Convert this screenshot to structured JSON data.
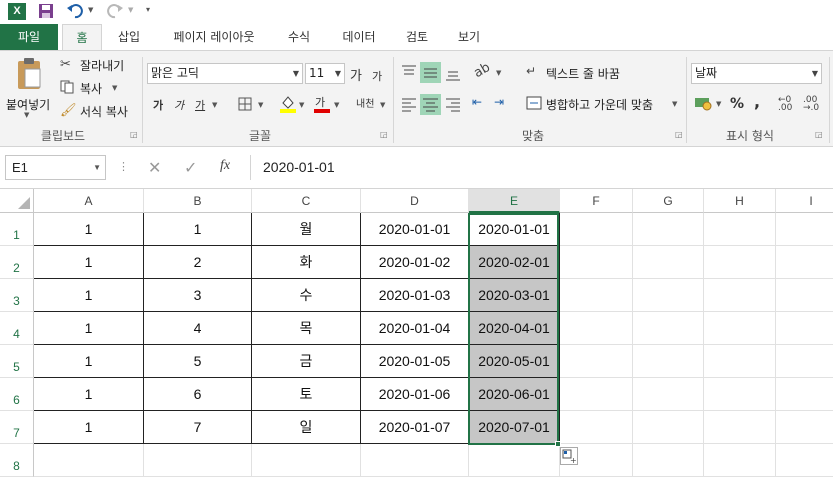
{
  "quick_access": {
    "app_icon": "excel-icon",
    "save_icon": "save-icon",
    "undo_icon": "undo-icon",
    "redo_icon": "redo-icon",
    "customize_icon": "customize-icon",
    "brand_color": "#217346"
  },
  "tabs": [
    {
      "label": "파일"
    },
    {
      "label": "홈"
    },
    {
      "label": "삽입"
    },
    {
      "label": "페이지 레이아웃"
    },
    {
      "label": "수식"
    },
    {
      "label": "데이터"
    },
    {
      "label": "검토"
    },
    {
      "label": "보기"
    }
  ],
  "ribbon": {
    "clipboard": {
      "paste_label": "붙여넣기",
      "cut_label": "잘라내기",
      "copy_label": "복사",
      "format_painter_label": "서식 복사",
      "group_label": "클립보드"
    },
    "font": {
      "font_name": "맑은 고딕",
      "font_size": "11",
      "bold": "가",
      "italic": "가",
      "underline": "가",
      "increase_size": "가",
      "decrease_size": "가",
      "font_color_label": "가",
      "phonetic_label": "내천",
      "group_label": "글꼴"
    },
    "alignment": {
      "wrap_text_label": "텍스트 줄 바꿈",
      "merge_center_label": "병합하고 가운데 맞춤",
      "group_label": "맞춤"
    },
    "number": {
      "format_value": "날짜",
      "percent": "%",
      "comma": ",",
      "group_label": "표시 형식"
    }
  },
  "formula_bar": {
    "name_box": "E1",
    "cancel_icon": "close-icon",
    "enter_icon": "check-icon",
    "fx_label": "fx",
    "formula_value": "2020-01-01"
  },
  "sheet": {
    "columns": [
      "A",
      "B",
      "C",
      "D",
      "E",
      "F",
      "G",
      "H",
      "I"
    ],
    "rows": [
      {
        "num": "1",
        "cells": [
          "1",
          "1",
          "월",
          "2020-01-01",
          "2020-01-01"
        ]
      },
      {
        "num": "2",
        "cells": [
          "1",
          "2",
          "화",
          "2020-01-02",
          "2020-02-01"
        ]
      },
      {
        "num": "3",
        "cells": [
          "1",
          "3",
          "수",
          "2020-01-03",
          "2020-03-01"
        ]
      },
      {
        "num": "4",
        "cells": [
          "1",
          "4",
          "목",
          "2020-01-04",
          "2020-04-01"
        ]
      },
      {
        "num": "5",
        "cells": [
          "1",
          "5",
          "금",
          "2020-01-05",
          "2020-05-01"
        ]
      },
      {
        "num": "6",
        "cells": [
          "1",
          "6",
          "토",
          "2020-01-06",
          "2020-06-01"
        ]
      },
      {
        "num": "7",
        "cells": [
          "1",
          "7",
          "일",
          "2020-01-07",
          "2020-07-01"
        ]
      },
      {
        "num": "8",
        "cells": [
          "",
          "",
          "",
          "",
          ""
        ]
      }
    ],
    "selected_column": "E",
    "fill_options_icon": "auto-fill-options-icon"
  }
}
